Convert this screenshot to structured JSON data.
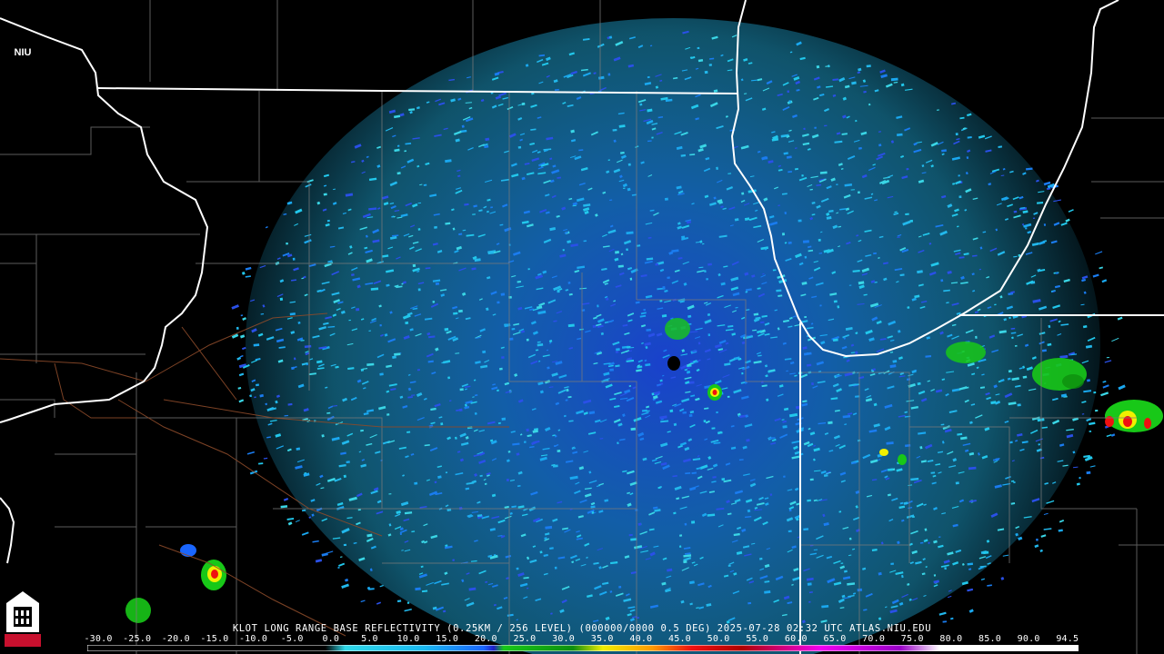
{
  "product": {
    "caption": "KLOT LONG RANGE BASE REFLECTIVITY (0.25KM / 256 LEVEL) (000000/0000 0.5 DEG) 2025-07-28 02:32 UTC  ATLAS.NIU.EDU",
    "logo_text": "NIU"
  },
  "legend": {
    "ticks": [
      "-30.0",
      "-25.0",
      "-20.0",
      "-15.0",
      "-10.0",
      "-5.0",
      "0.0",
      "5.0",
      "10.0",
      "15.0",
      "20.0",
      "25.0",
      "30.0",
      "35.0",
      "40.0",
      "45.0",
      "50.0",
      "55.0",
      "60.0",
      "65.0",
      "70.0",
      "75.0",
      "80.0",
      "85.0",
      "90.0",
      "94.5"
    ],
    "colors": {
      "black": "#000000",
      "lightcyan": "#2fd8e8",
      "cyan": "#19b8f0",
      "blue": "#1a66ff",
      "darkblue": "#1e1ec8",
      "green": "#18c818",
      "darkgreen": "#0e8f0e",
      "yellow": "#f0f000",
      "orange": "#ff9a00",
      "red": "#f01010",
      "darkred": "#b00000",
      "magenta": "#f000f0",
      "purple": "#9a00c8",
      "white": "#ffffff"
    }
  },
  "map": {
    "state_border_color": "#ffffff",
    "county_border_color": "#808080",
    "highway_color": "#8b4a2a",
    "radar_site_color": "#000000"
  }
}
